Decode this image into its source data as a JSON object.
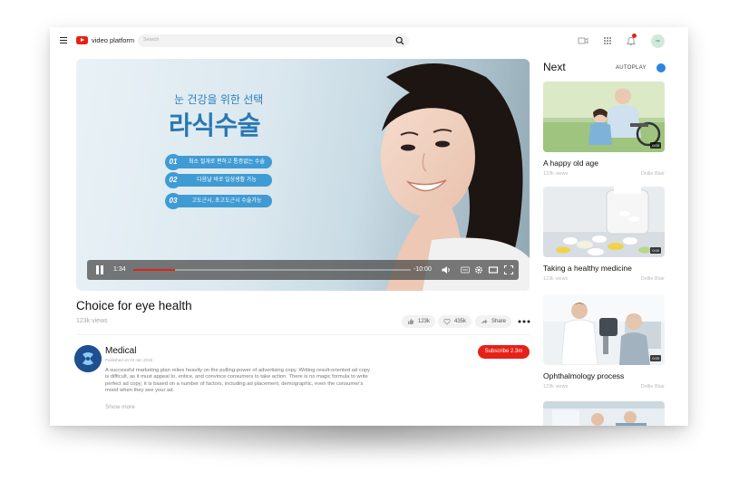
{
  "header": {
    "logo_text": "video platform",
    "search_placeholder": "Search",
    "avatar_text": "DE"
  },
  "player": {
    "ad": {
      "subtitle": "눈 건강을 위한 선택",
      "title": "라식수술",
      "items": [
        {
          "num": "01",
          "text": "최소 절개로 편하고 통증없는 수술"
        },
        {
          "num": "02",
          "text": "다음날 바로 일상생활 가능"
        },
        {
          "num": "03",
          "text": "고도근시, 초고도근시 수술가능"
        }
      ]
    },
    "current_time": "1:34",
    "remaining_time": "-10:00",
    "progress": 0.15
  },
  "video": {
    "title": "Choice for eye health",
    "views": "123k views",
    "likes": "123k",
    "favorites": "435k",
    "share_label": "Share"
  },
  "channel": {
    "name": "Medical",
    "published": "Published on 04 Jun 2019",
    "description": "A successful marketing plan relies heavily on the pulling-power of advertising copy. Writing result-oriented ad copy is difficult, as it must appeal to, entice, and convince consumers to take action. There is no magic formula to write perfect ad copy; it is based on a number of factors, including ad placement, demographic, even the consumer's mood when they see your ad.",
    "show_more": "Show more",
    "subscribe_label": "Subscribe 2.3m"
  },
  "sidebar": {
    "next_label": "Next",
    "autoplay_label": "AUTOPLAY",
    "videos": [
      {
        "title": "A happy old age",
        "views": "123k views",
        "author": "Dollie Blair",
        "duration": "0:00"
      },
      {
        "title": "Taking a healthy medicine",
        "views": "123k views",
        "author": "Dollie Blair",
        "duration": "0:00"
      },
      {
        "title": "Ophthalmology process",
        "views": "123k views",
        "author": "Dollie Blair",
        "duration": "0:00"
      }
    ]
  },
  "colors": {
    "brand_red": "#e62117",
    "ad_blue": "#3f9bd3",
    "toggle_blue": "#2b84e0"
  }
}
